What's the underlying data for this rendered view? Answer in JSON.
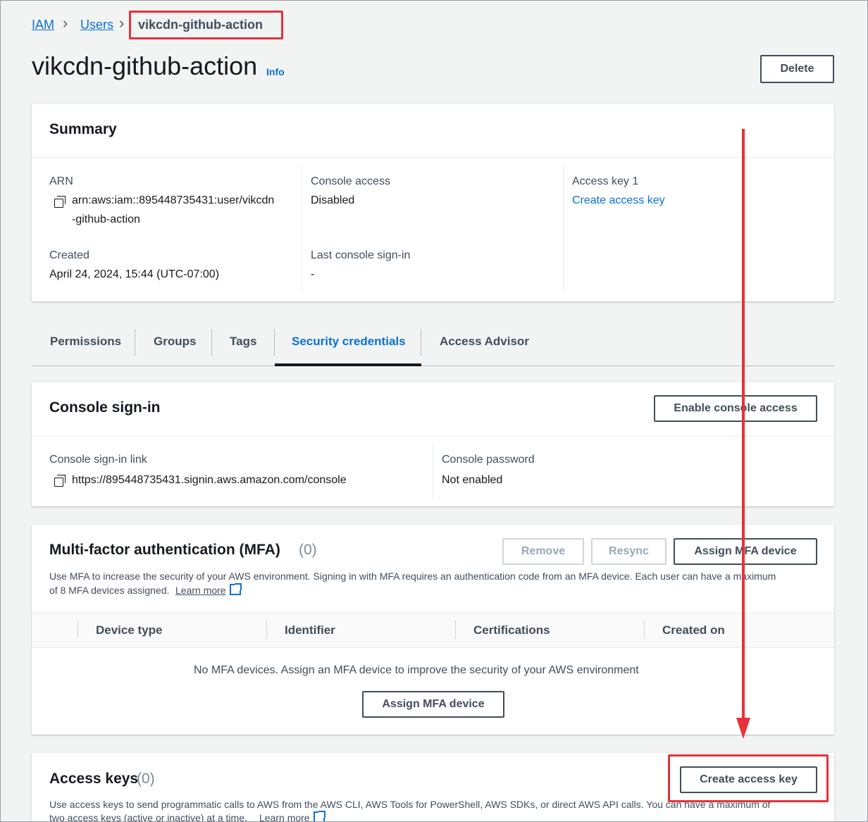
{
  "breadcrumb": {
    "iam": "IAM",
    "users": "Users",
    "current": "vikcdn-github-action"
  },
  "page": {
    "title": "vikcdn-github-action",
    "info": "Info",
    "delete": "Delete"
  },
  "summary": {
    "heading": "Summary",
    "arn_label": "ARN",
    "arn_line1": "arn:aws:iam::895448735431:user/vikcdn",
    "arn_line2": "-github-action",
    "created_label": "Created",
    "created_value": "April 24, 2024, 15:44 (UTC-07:00)",
    "console_access_label": "Console access",
    "console_access_value": "Disabled",
    "last_signin_label": "Last console sign-in",
    "last_signin_value": "-",
    "access_key_label": "Access key 1",
    "access_key_link": "Create access key"
  },
  "tabs": [
    "Permissions",
    "Groups",
    "Tags",
    "Security credentials",
    "Access Advisor"
  ],
  "console_signin": {
    "heading": "Console sign-in",
    "enable_button": "Enable console access",
    "link_label": "Console sign-in link",
    "link_value": "https://895448735431.signin.aws.amazon.com/console",
    "password_label": "Console password",
    "password_value": "Not enabled"
  },
  "mfa": {
    "heading": "Multi-factor authentication (MFA)",
    "count": "(0)",
    "remove": "Remove",
    "resync": "Resync",
    "assign": "Assign MFA device",
    "desc1": "Use MFA to increase the security of your AWS environment. Signing in with MFA requires an authentication code from an MFA device. Each user can have a maximum",
    "desc2": "of 8 MFA devices assigned.",
    "learn_more": "Learn more",
    "columns": [
      "Device type",
      "Identifier",
      "Certifications",
      "Created on"
    ],
    "empty": "No MFA devices. Assign an MFA device to improve the security of your AWS environment",
    "empty_button": "Assign MFA device"
  },
  "access_keys": {
    "heading": "Access keys",
    "count": "(0)",
    "create": "Create access key",
    "desc1": "Use access keys to send programmatic calls to AWS from the AWS CLI, AWS Tools for PowerShell, AWS SDKs, or direct AWS API calls. You can have a maximum of",
    "desc2": "two access keys (active or inactive) at a time.",
    "learn_more": "Learn more"
  },
  "colors": {
    "link": "#0972d3",
    "annotation": "#e8313a",
    "active_tab_underline": "#16191f"
  }
}
